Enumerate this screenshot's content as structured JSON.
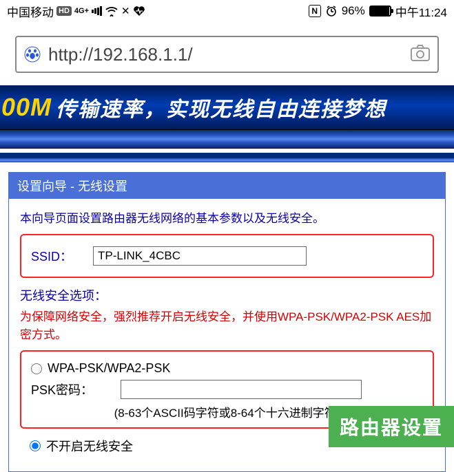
{
  "status": {
    "carrier": "中国移动",
    "hd": "HD",
    "net": "4G+",
    "nfc": "N",
    "battery_pct": "96%",
    "time": "中午11:24"
  },
  "url": "http://192.168.1.1/",
  "banner": {
    "left": "00M",
    "text": "传输速率，实现无线自由连接梦想"
  },
  "panel": {
    "title": "设置向导 - 无线设置",
    "intro": "本向导页面设置路由器无线网络的基本参数以及无线安全。",
    "ssid_label": "SSID：",
    "ssid_value": "TP-LINK_4CBC",
    "security_head": "无线安全选项：",
    "warning": "为保障网络安全，强烈推荐开启无线安全，并使用WPA-PSK/WPA2-PSK AES加密方式。",
    "option_wpa": "WPA-PSK/WPA2-PSK",
    "psk_label": "PSK密码：",
    "psk_value": "",
    "psk_hint": "(8-63个ASCII码字符或8-64个十六进制字符)",
    "option_none": "不开启无线安全"
  },
  "watermark": "路由器设置"
}
